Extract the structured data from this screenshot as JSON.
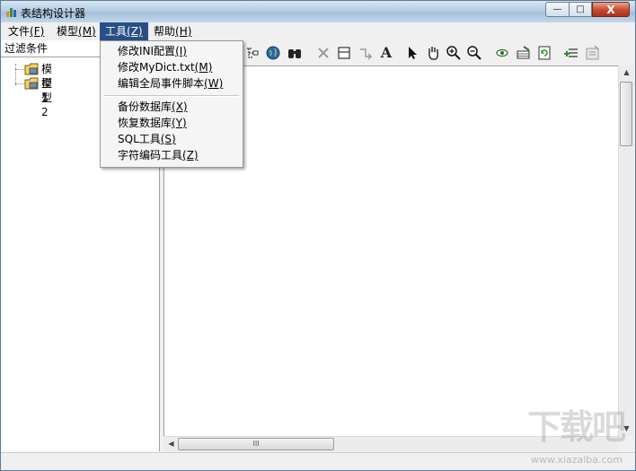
{
  "window": {
    "title": "表结构设计器",
    "controls": {
      "minimize": "—",
      "maximize": "□",
      "close": "X"
    }
  },
  "menubar": {
    "items": [
      {
        "text": "文件",
        "key": "(F)"
      },
      {
        "text": "模型",
        "key": "(M)"
      },
      {
        "text": "工具",
        "key": "(Z)"
      },
      {
        "text": "帮助",
        "key": "(H)"
      }
    ]
  },
  "tools_menu": {
    "items": [
      {
        "text": "修改INI配置",
        "key": "(I)"
      },
      {
        "text": "修改MyDict.txt",
        "key": "(M)"
      },
      {
        "text": "编辑全局事件脚本",
        "key": "(W)"
      },
      {
        "text": "备份数据库",
        "key": "(X)"
      },
      {
        "text": "恢复数据库",
        "key": "(Y)"
      },
      {
        "text": "SQL工具",
        "key": "(S)"
      },
      {
        "text": "字符编码工具",
        "key": "(Z)"
      }
    ]
  },
  "left_panel": {
    "filter_label": "过滤条件",
    "tree": [
      "模型1",
      "模型2"
    ]
  },
  "toolbar": {
    "icons": [
      "tree-connector-icon",
      "globe-icon",
      "binoculars-icon",
      "delete-x-icon",
      "table-box-icon",
      "link-arrow-icon",
      "text-A-icon",
      "pointer-arrow-icon",
      "hand-pan-icon",
      "zoom-in-icon",
      "zoom-out-icon",
      "eye-icon",
      "database-edit-icon",
      "refresh-doc-icon",
      "add-field-icon",
      "properties-icon"
    ],
    "text_glyph": "A"
  },
  "scrollbar": {
    "grip": "III"
  },
  "watermark": {
    "logo": "下载吧",
    "url": "www.xiazaiba.com"
  },
  "colors": {
    "menu_highlight": "#2a4f86",
    "close_button": "#c4492f"
  }
}
